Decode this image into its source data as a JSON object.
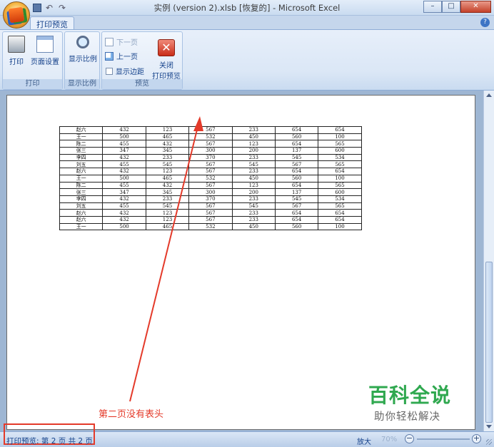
{
  "window": {
    "title": "实例 (version 2).xlsb  [恢复的] - Microsoft Excel"
  },
  "tabs": [
    {
      "label": "打印预览"
    }
  ],
  "ribbon": {
    "groups": [
      {
        "label": "打印",
        "buttons": [
          {
            "label": "打印",
            "icon": "printer-icon"
          },
          {
            "label": "页面设置",
            "icon": "page-setup-icon"
          }
        ]
      },
      {
        "label": "显示比例",
        "buttons": [
          {
            "label": "显示比例",
            "icon": "zoom-magnifier-icon"
          }
        ]
      },
      {
        "label": "预览",
        "next_page": "下一页",
        "prev_page": "上一页",
        "show_margins": "显示边距",
        "close_line1": "关闭",
        "close_line2": "打印预览"
      }
    ]
  },
  "sheet_rows": [
    [
      "赵六",
      "432",
      "123",
      "567",
      "233",
      "654",
      "654"
    ],
    [
      "王一",
      "500",
      "465",
      "532",
      "450",
      "560",
      "100"
    ],
    [
      "陈二",
      "455",
      "432",
      "567",
      "123",
      "654",
      "565"
    ],
    [
      "张三",
      "347",
      "345",
      "300",
      "200",
      "137",
      "600"
    ],
    [
      "李四",
      "432",
      "233",
      "370",
      "233",
      "545",
      "534"
    ],
    [
      "刘五",
      "455",
      "545",
      "567",
      "545",
      "567",
      "565"
    ],
    [
      "赵六",
      "432",
      "123",
      "567",
      "233",
      "654",
      "654"
    ],
    [
      "王一",
      "500",
      "465",
      "532",
      "450",
      "560",
      "100"
    ],
    [
      "陈二",
      "455",
      "432",
      "567",
      "123",
      "654",
      "565"
    ],
    [
      "张三",
      "347",
      "345",
      "300",
      "200",
      "137",
      "600"
    ],
    [
      "李四",
      "432",
      "233",
      "370",
      "233",
      "545",
      "534"
    ],
    [
      "刘五",
      "455",
      "545",
      "567",
      "545",
      "567",
      "565"
    ],
    [
      "赵六",
      "432",
      "123",
      "567",
      "233",
      "654",
      "654"
    ],
    [
      "赵六",
      "432",
      "123",
      "567",
      "233",
      "654",
      "654"
    ],
    [
      "王一",
      "500",
      "465",
      "532",
      "450",
      "560",
      "100"
    ]
  ],
  "annotation": {
    "text": "第二页没有表头",
    "color": "#e43a2a"
  },
  "watermark": {
    "title": "百科全说",
    "subtitle": "助你轻松解决"
  },
  "status": {
    "text": "打印预览: 第 2 页 共 2 页",
    "zoom_in_label": "放大",
    "zoom_level": "70%"
  }
}
